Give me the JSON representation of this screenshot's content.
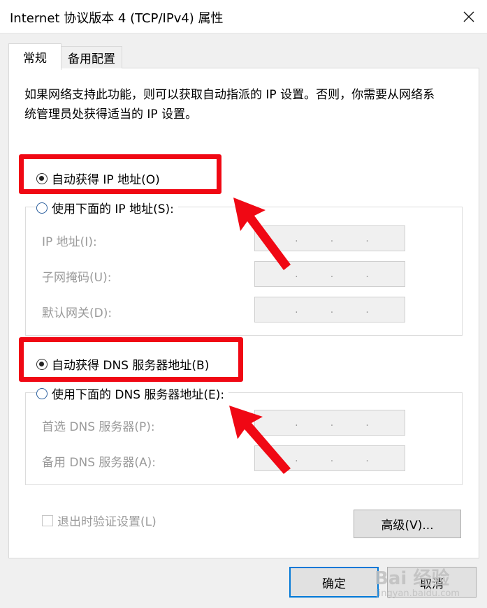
{
  "window": {
    "title": "Internet 协议版本 4 (TCP/IPv4) 属性"
  },
  "tabs": [
    {
      "label": "常规"
    },
    {
      "label": "备用配置"
    }
  ],
  "description": "如果网络支持此功能，则可以获取自动指派的 IP 设置。否则，你需要从网络系统管理员处获得适当的 IP 设置。",
  "ip_section": {
    "auto_label": "自动获得 IP 地址(O)",
    "auto_selected": true,
    "manual_label": "使用下面的 IP 地址(S):",
    "fields": [
      {
        "label": "IP 地址(I):"
      },
      {
        "label": "子网掩码(U):"
      },
      {
        "label": "默认网关(D):"
      }
    ]
  },
  "dns_section": {
    "auto_label": "自动获得 DNS 服务器地址(B)",
    "auto_selected": true,
    "manual_label": "使用下面的 DNS 服务器地址(E):",
    "fields": [
      {
        "label": "首选 DNS 服务器(P):"
      },
      {
        "label": "备用 DNS 服务器(A):"
      }
    ]
  },
  "validate_label": "退出时验证设置(L)",
  "advanced_label": "高级(V)...",
  "ok_label": "确定",
  "cancel_label": "取消",
  "ip_dot": ".",
  "watermark": {
    "brand": "Bai  经验",
    "url": "jingyan.baidu.com"
  },
  "colors": {
    "highlight": "#f00814",
    "ok_border": "#0078d7"
  }
}
